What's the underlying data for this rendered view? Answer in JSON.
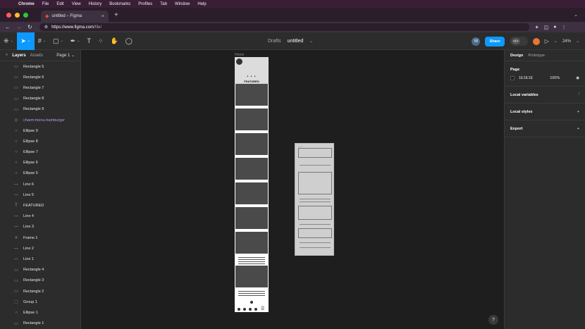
{
  "mac_menu": {
    "apple": "",
    "app": "Chrome",
    "items": [
      "File",
      "Edit",
      "View",
      "History",
      "Bookmarks",
      "Profiles",
      "Tab",
      "Window",
      "Help"
    ]
  },
  "browser": {
    "tab_title": "untitled – Figma",
    "url_host": "https://www.figma.com",
    "url_path": "/file/"
  },
  "figma_toolbar": {
    "breadcrumb_drafts": "Drafts",
    "file_name": "untitled",
    "avatar_initial": "M",
    "share_label": "Share",
    "dev_mode_label": "</>",
    "zoom": "24%"
  },
  "left_panel": {
    "tab_layers": "Layers",
    "tab_assets": "Assets",
    "page_selector": "Page 1",
    "layers": [
      {
        "name": "Rectangle 5",
        "icon": "rect-icon",
        "glyph": "▭",
        "component": false
      },
      {
        "name": "Rectangle 6",
        "icon": "rect-icon",
        "glyph": "▭",
        "component": false
      },
      {
        "name": "Rectangle 7",
        "icon": "rect-icon",
        "glyph": "▭",
        "component": false
      },
      {
        "name": "Rectangle 8",
        "icon": "rect-icon",
        "glyph": "▭",
        "component": false
      },
      {
        "name": "Rectangle 9",
        "icon": "rect-icon",
        "glyph": "▭",
        "component": false
      },
      {
        "name": "charm:menu-hamburger",
        "icon": "component-icon",
        "glyph": "◇",
        "component": true
      },
      {
        "name": "Ellipse 9",
        "icon": "ellipse-icon",
        "glyph": "○",
        "component": false
      },
      {
        "name": "Ellipse 8",
        "icon": "ellipse-icon",
        "glyph": "○",
        "component": false
      },
      {
        "name": "Ellipse 7",
        "icon": "ellipse-icon",
        "glyph": "○",
        "component": false
      },
      {
        "name": "Ellipse 6",
        "icon": "ellipse-icon",
        "glyph": "○",
        "component": false
      },
      {
        "name": "Ellipse 5",
        "icon": "ellipse-icon",
        "glyph": "○",
        "component": false
      },
      {
        "name": "Line 6",
        "icon": "line-icon",
        "glyph": "—",
        "component": false
      },
      {
        "name": "Line 5",
        "icon": "line-icon",
        "glyph": "—",
        "component": false
      },
      {
        "name": "FEATURED",
        "icon": "text-icon",
        "glyph": "T",
        "component": false
      },
      {
        "name": "Line 4",
        "icon": "line-icon",
        "glyph": "—",
        "component": false
      },
      {
        "name": "Line 3",
        "icon": "line-icon",
        "glyph": "—",
        "component": false
      },
      {
        "name": "Frame 1",
        "icon": "frame-icon",
        "glyph": "#",
        "component": false
      },
      {
        "name": "Line 2",
        "icon": "line-icon",
        "glyph": "—",
        "component": false
      },
      {
        "name": "Line 1",
        "icon": "line-icon",
        "glyph": "—",
        "component": false
      },
      {
        "name": "Rectangle 4",
        "icon": "rect-icon",
        "glyph": "▭",
        "component": false
      },
      {
        "name": "Rectangle 3",
        "icon": "rect-icon",
        "glyph": "▭",
        "component": false
      },
      {
        "name": "Rectangle 2",
        "icon": "rect-icon",
        "glyph": "▭",
        "component": false
      },
      {
        "name": "Group 1",
        "icon": "group-icon",
        "glyph": "⬚",
        "component": false
      },
      {
        "name": "Ellipse 1",
        "icon": "ellipse-icon",
        "glyph": "○",
        "component": false
      },
      {
        "name": "Rectangle 1",
        "icon": "rect-icon",
        "glyph": "▭",
        "component": false
      }
    ]
  },
  "canvas": {
    "frame_label": "Home",
    "featured_text": "FEATURED",
    "dots": "• • •"
  },
  "right_panel": {
    "tab_design": "Design",
    "tab_prototype": "Prototype",
    "page_title": "Page",
    "page_color": "1E1E1E",
    "page_opacity": "100%",
    "local_variables": "Local variables",
    "local_styles": "Local styles",
    "export": "Export"
  },
  "colors": {
    "accent": "#0d99ff",
    "bg": "#1e1e1e",
    "panel": "#2c2c2c"
  }
}
